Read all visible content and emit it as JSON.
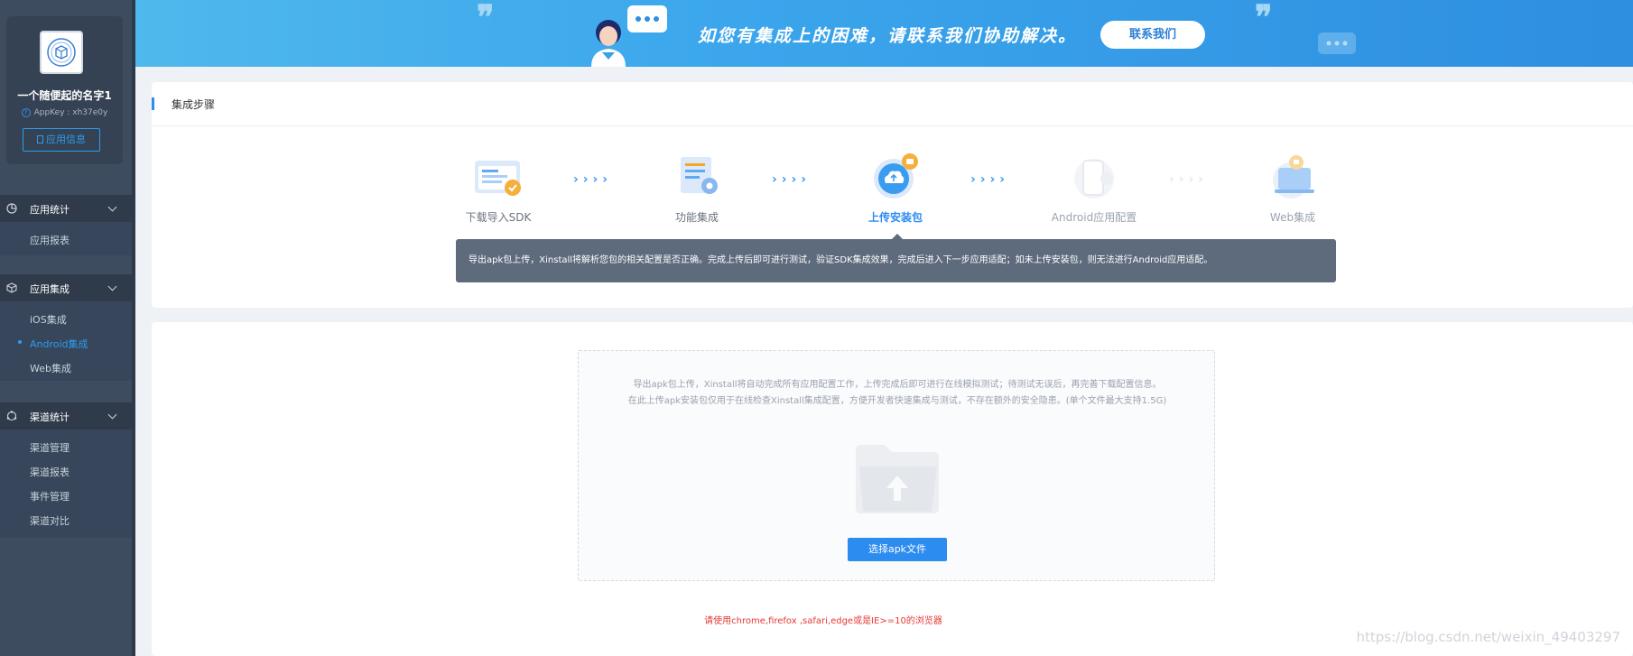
{
  "app": {
    "name": "一个随便起的名字1",
    "appkey": "AppKey : xh37e0y",
    "info_button": "应用信息"
  },
  "nav": {
    "groups": [
      {
        "label": "应用统计",
        "icon": "pie-chart-icon",
        "items": [
          "应用报表"
        ]
      },
      {
        "label": "应用集成",
        "icon": "cube-icon",
        "items": [
          "iOS集成",
          "Android集成",
          "Web集成"
        ],
        "active": "Android集成"
      },
      {
        "label": "渠道统计",
        "icon": "share-nodes-icon",
        "items": [
          "渠道管理",
          "渠道报表",
          "事件管理",
          "渠道对比"
        ]
      }
    ]
  },
  "banner": {
    "text": "如您有集成上的困难，请联系我们协助解决。",
    "button": "联系我们"
  },
  "steps": {
    "title": "集成步骤",
    "items": [
      {
        "label": "下载导入SDK",
        "icon": "download-sdk-icon",
        "state": "done"
      },
      {
        "label": "功能集成",
        "icon": "feature-integration-icon",
        "state": "done"
      },
      {
        "label": "上传安装包",
        "icon": "upload-cloud-icon",
        "state": "active"
      },
      {
        "label": "Android应用配置",
        "icon": "android-phone-icon",
        "state": "disabled"
      },
      {
        "label": "Web集成",
        "icon": "web-laptop-icon",
        "state": "disabled"
      }
    ],
    "tooltip": "导出apk包上传，Xinstall将解析您包的相关配置是否正确。完成上传后即可进行测试，验证SDK集成效果，完成后进入下一步应用适配；如未上传安装包，则无法进行Android应用适配。"
  },
  "upload": {
    "desc_line1": "导出apk包上传，Xinstall将自动完成所有应用配置工作，上传完成后即可进行在线模拟测试；待测试无误后，再完善下载配置信息。",
    "desc_line2": "在此上传apk安装包仅用于在线检查Xinstall集成配置，方便开发者快速集成与测试，不存在额外的安全隐患。(单个文件最大支持1.5G)",
    "button": "选择apk文件",
    "browser_note": "请使用chrome,firefox ,safari,edge或是IE>=10的浏览器"
  },
  "watermark": "https://blog.csdn.net/weixin_49403297",
  "colors": {
    "accent": "#2d8cf0",
    "sidebar": "#3d4c5f",
    "error": "#e53935"
  }
}
